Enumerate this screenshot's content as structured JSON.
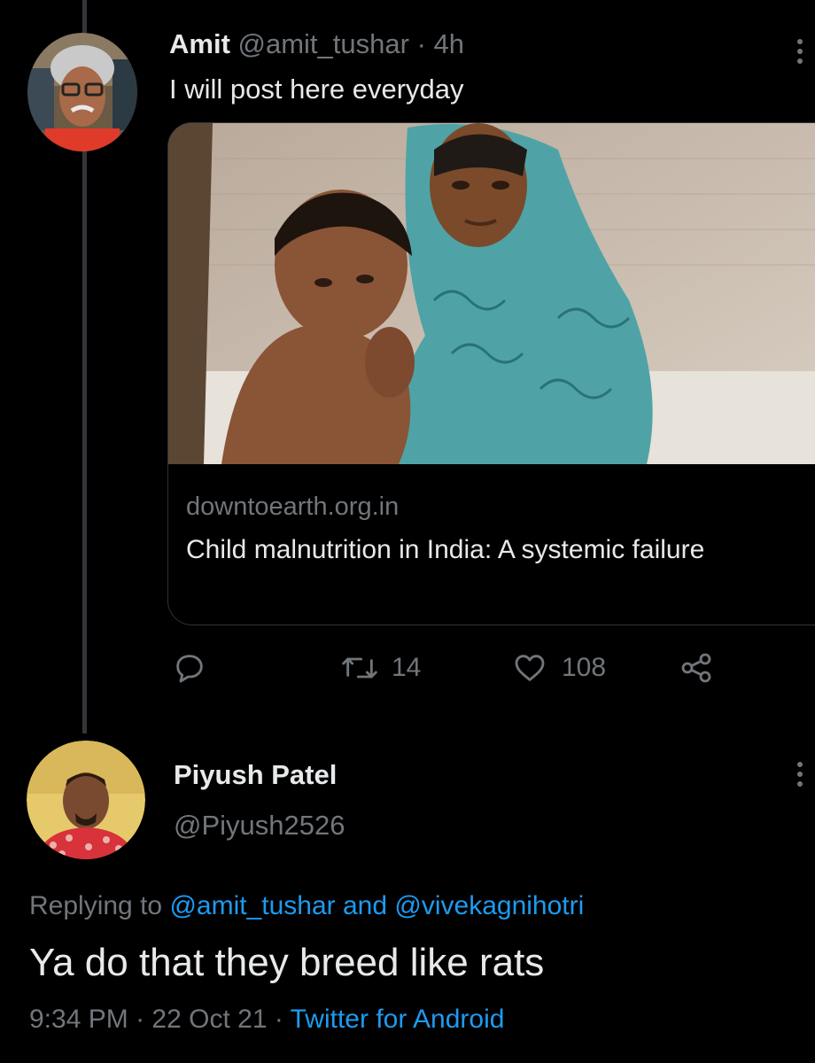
{
  "tweet": {
    "author_name": "Amit",
    "author_handle": "@amit_tushar",
    "separator": "·",
    "time_ago": "4h",
    "text": "I will post here everyday",
    "more_icon": "more-vertical-icon",
    "card": {
      "domain": "downtoearth.org.in",
      "title": "Child malnutrition in India: A systemic failure"
    },
    "actions": {
      "reply_icon": "reply-icon",
      "retweet_icon": "retweet-icon",
      "retweet_count": "14",
      "like_icon": "heart-icon",
      "like_count": "108",
      "share_icon": "share-icon"
    }
  },
  "reply": {
    "author_name": "Piyush Patel",
    "author_handle": "@Piyush2526",
    "more_icon": "more-vertical-icon",
    "replying_prefix": "Replying to",
    "replying_user1": "@amit_tushar",
    "replying_and": "and",
    "replying_user2": "@vivekagnihotri",
    "text": "Ya do that they breed like rats",
    "time": "9:34 PM",
    "dot1": "·",
    "date": "22 Oct 21",
    "dot2": "·",
    "source": "Twitter for Android"
  },
  "colors": {
    "background": "#000000",
    "text": "#e7e9ea",
    "muted": "#71767b",
    "link": "#1d9bf0",
    "border": "#2f3336"
  }
}
